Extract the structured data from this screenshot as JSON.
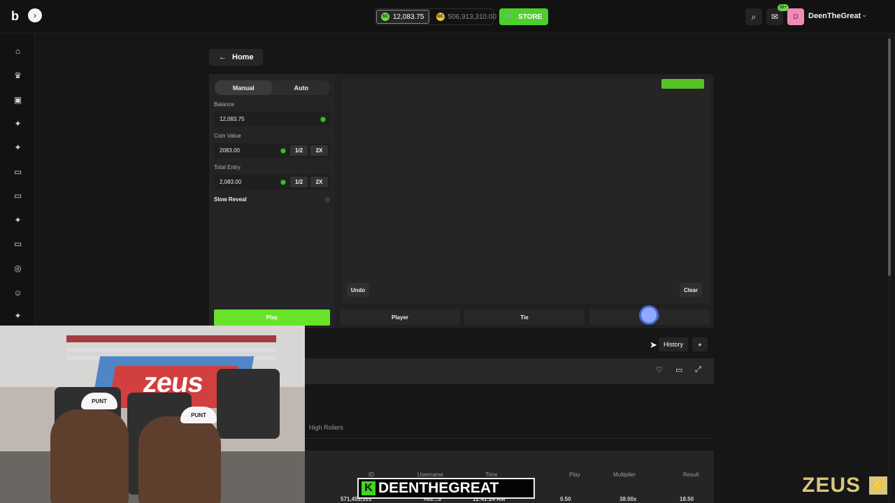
{
  "topbar": {
    "logo": "b",
    "menu_icon": "›",
    "wallet": {
      "sc_badge": "SC",
      "sc_balance": "12,083.75",
      "gc_badge": "GC",
      "gc_balance": "506,913,310.00"
    },
    "store_label": "STORE",
    "search_icon": "⌕",
    "mail_icon": "✉",
    "mail_badge": "99+",
    "avatar_letter": "D",
    "username": "DeenTheGreat",
    "dropdown_icon": "⌄"
  },
  "sidebar_icons": [
    "⌂",
    "♛",
    "▣",
    "✦",
    "✦",
    "▭",
    "▭",
    "✦",
    "▭",
    "◎",
    "☺",
    "✦"
  ],
  "back_label": "Home",
  "game": {
    "mode_manual": "Manual",
    "mode_auto": "Auto",
    "balance_label": "Balance",
    "balance_value": "12,083.75",
    "coin_value_label": "Coin Value",
    "coin_value": "2083.00",
    "total_entry_label": "Total Entry",
    "total_entry_value": "2,083.00",
    "half_label": "1/2",
    "double_label": "2X",
    "slow_reveal_label": "Slow Reveal",
    "play_label": "Play",
    "undo_label": "Undo",
    "clear_label": "Clear",
    "player_label": "Player",
    "tie_label": "Tie",
    "banker_label": "Banker"
  },
  "history_label": "History",
  "tabs": {
    "high_rollers": "High Rollers"
  },
  "table": {
    "headers": [
      "ID",
      "Username",
      "Time",
      "Play",
      "Multiplier",
      "Result"
    ],
    "row": [
      "571,453,101",
      "Hid...S",
      "12:41:24 AM",
      "0.50",
      "38.00x",
      "18.50"
    ]
  },
  "stream_overlay": {
    "k": "K",
    "name": "DEENTHEGREAT"
  },
  "webcam": {
    "banner_text": "zeus",
    "cap1": "PUNT",
    "cap2": "PUNT"
  },
  "brand": {
    "name": "ZEUS",
    "bolt": "⚡"
  },
  "colors": {
    "accent_green": "#68e32a",
    "store_green": "#4fcf2b",
    "brand_gold": "#d9c77c"
  }
}
